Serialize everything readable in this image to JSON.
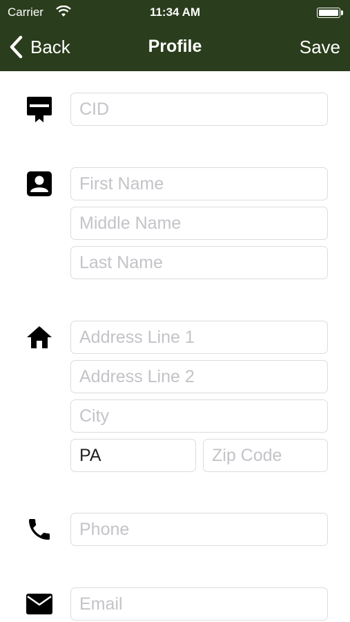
{
  "status_bar": {
    "carrier": "Carrier",
    "time": "11:34 AM",
    "wifi_icon": "wifi-icon",
    "battery_icon": "battery-icon"
  },
  "nav": {
    "back_label": "Back",
    "title": "Profile",
    "save_label": "Save",
    "back_icon": "chevron-left-icon"
  },
  "colors": {
    "nav_background": "#2a3d1c",
    "nav_text": "#ffffff",
    "placeholder": "#c3c3c8",
    "field_border": "#dcdcdc"
  },
  "form": {
    "cid": {
      "icon": "id-card-icon",
      "placeholder": "CID",
      "value": ""
    },
    "name": {
      "icon": "contact-icon",
      "first_placeholder": "First Name",
      "middle_placeholder": "Middle Name",
      "last_placeholder": "Last Name"
    },
    "address": {
      "icon": "home-icon",
      "line1_placeholder": "Address Line 1",
      "line2_placeholder": "Address Line 2",
      "city_placeholder": "City",
      "state_value": "PA",
      "zip_placeholder": "Zip Code"
    },
    "phone": {
      "icon": "phone-icon",
      "placeholder": "Phone"
    },
    "email": {
      "icon": "mail-icon",
      "placeholder": "Email"
    }
  }
}
